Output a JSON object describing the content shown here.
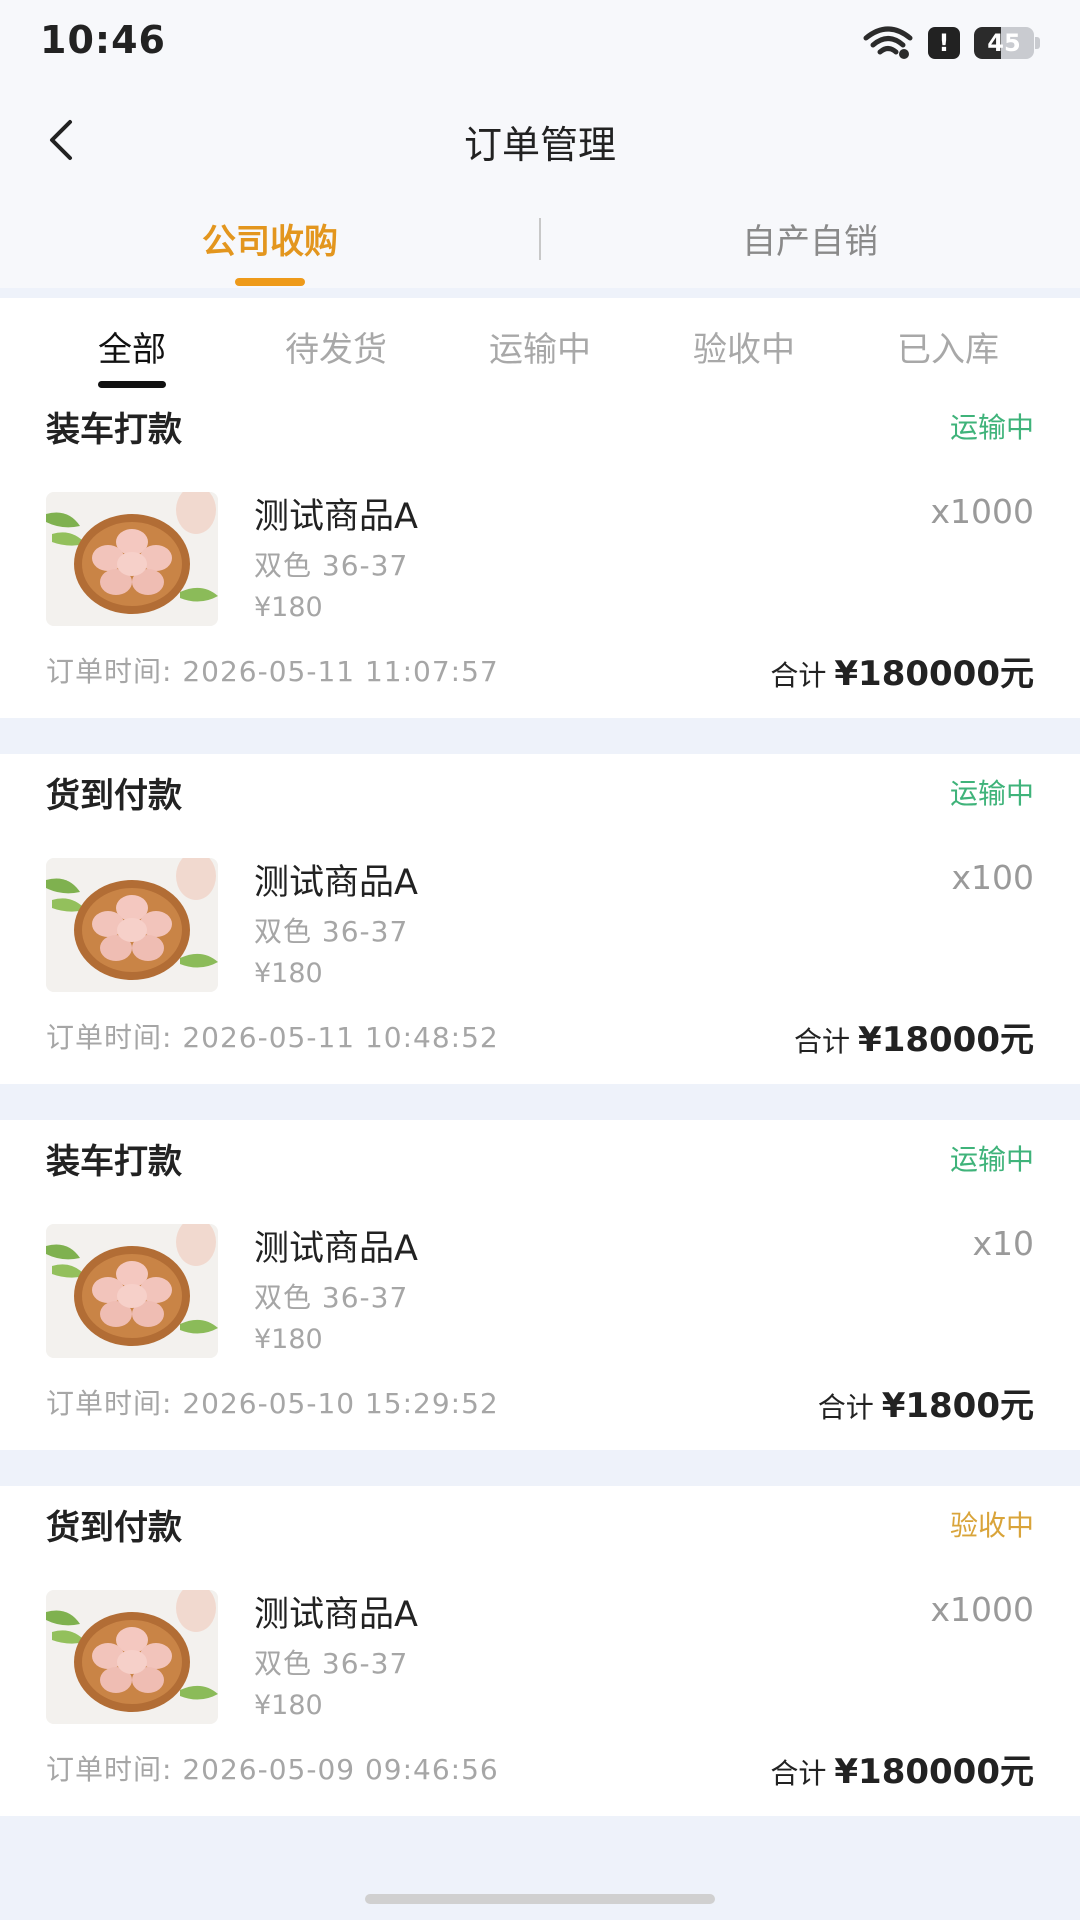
{
  "status_bar": {
    "time": "10:46",
    "battery": "45",
    "battery_level": 0.45,
    "alert": "!"
  },
  "nav": {
    "title": "订单管理"
  },
  "top_tabs": [
    {
      "label": "公司收购",
      "active": true
    },
    {
      "label": "自产自销",
      "active": false
    }
  ],
  "filter_tabs": [
    {
      "label": "全部",
      "active": true
    },
    {
      "label": "待发货",
      "active": false
    },
    {
      "label": "运输中",
      "active": false
    },
    {
      "label": "验收中",
      "active": false
    },
    {
      "label": "已入库",
      "active": false
    }
  ],
  "orders": [
    {
      "pay_type": "装车打款",
      "status": "运输中",
      "status_color": "#3fb37a",
      "product": "测试商品A",
      "spec": "双色 36-37",
      "price": "¥180",
      "quantity": "x1000",
      "time_label": "订单时间:",
      "time": "2026-05-11 11:07:57",
      "total_label": "合计",
      "total": "¥180000元"
    },
    {
      "pay_type": "货到付款",
      "status": "运输中",
      "status_color": "#3fb37a",
      "product": "测试商品A",
      "spec": "双色 36-37",
      "price": "¥180",
      "quantity": "x100",
      "time_label": "订单时间:",
      "time": "2026-05-11 10:48:52",
      "total_label": "合计",
      "total": "¥18000元"
    },
    {
      "pay_type": "装车打款",
      "status": "运输中",
      "status_color": "#3fb37a",
      "product": "测试商品A",
      "spec": "双色 36-37",
      "price": "¥180",
      "quantity": "x10",
      "time_label": "订单时间:",
      "time": "2026-05-10 15:29:52",
      "total_label": "合计",
      "total": "¥1800元"
    },
    {
      "pay_type": "货到付款",
      "status": "验收中",
      "status_color": "#d9a43a",
      "product": "测试商品A",
      "spec": "双色 36-37",
      "price": "¥180",
      "quantity": "x1000",
      "time_label": "订单时间:",
      "time": "2026-05-09 09:46:56",
      "total_label": "合计",
      "total": "¥180000元"
    }
  ],
  "icons": {
    "back": "back-arrow-icon",
    "wifi": "wifi-icon",
    "alert": "alert-icon",
    "battery": "battery-icon",
    "product": "egg-product-icon"
  }
}
